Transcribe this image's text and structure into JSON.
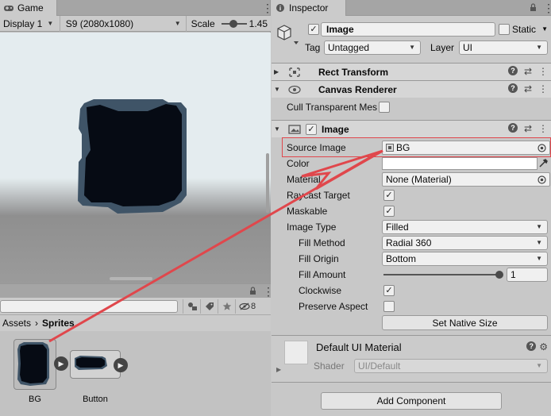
{
  "game_panel": {
    "tab_label": "Game",
    "display_label": "Display 1",
    "resolution_label": "S9 (2080x1080)",
    "scale_label": "Scale",
    "scale_value": "1.45"
  },
  "project_panel": {
    "breadcrumb": {
      "root": "Assets",
      "separator": "›",
      "current": "Sprites"
    },
    "hidden_count": "8",
    "assets": [
      {
        "label": "BG"
      },
      {
        "label": "Button"
      }
    ]
  },
  "inspector": {
    "tab_label": "Inspector",
    "object_name": "Image",
    "static_label": "Static",
    "tag_label": "Tag",
    "tag_value": "Untagged",
    "layer_label": "Layer",
    "layer_value": "UI",
    "components": {
      "rect_transform": {
        "title": "Rect Transform"
      },
      "canvas_renderer": {
        "title": "Canvas Renderer",
        "cull_label": "Cull Transparent Mes"
      },
      "image": {
        "title": "Image",
        "source_image_label": "Source Image",
        "source_image_value": "BG",
        "color_label": "Color",
        "material_label": "Material",
        "material_value": "None (Material)",
        "raycast_label": "Raycast Target",
        "maskable_label": "Maskable",
        "image_type_label": "Image Type",
        "image_type_value": "Filled",
        "fill_method_label": "Fill Method",
        "fill_method_value": "Radial 360",
        "fill_origin_label": "Fill Origin",
        "fill_origin_value": "Bottom",
        "fill_amount_label": "Fill Amount",
        "fill_amount_value": "1",
        "clockwise_label": "Clockwise",
        "preserve_label": "Preserve Aspect",
        "set_native_size_label": "Set Native Size"
      }
    },
    "material_section": {
      "name": "Default UI Material",
      "shader_label": "Shader",
      "shader_value": "UI/Default"
    },
    "add_component_label": "Add Component"
  },
  "checkbox_glyph": "✓",
  "colors": {
    "annotation_red": "#e0474c",
    "sprite_dark": "#060b14",
    "sprite_edge": "#3f5467"
  }
}
